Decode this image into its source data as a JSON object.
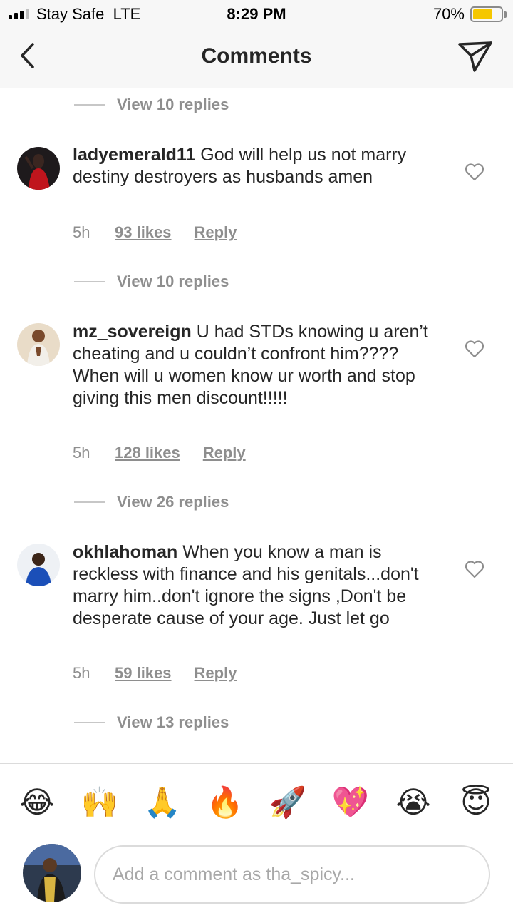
{
  "status_bar": {
    "carrier": "Stay Safe",
    "network": "LTE",
    "time": "8:29 PM",
    "battery": "70%",
    "battery_level": 0.7
  },
  "header": {
    "title": "Comments",
    "back_icon": "chevron-left-icon",
    "share_icon": "paper-plane-icon"
  },
  "view_replies": [
    {
      "label": "View 10 replies"
    },
    {
      "label": "View 10 replies"
    },
    {
      "label": "View 26 replies"
    },
    {
      "label": "View 13 replies"
    }
  ],
  "comments": [
    {
      "username": "ladyemerald11",
      "text": "God will help us not marry destiny destroyers as husbands amen",
      "time": "5h",
      "likes": "93 likes",
      "reply": "Reply"
    },
    {
      "username": "mz_sovereign",
      "text": "U had STDs knowing u aren’t cheating and u couldn’t confront him???? When will u women know ur worth and stop giving this men discount!!!!!",
      "time": "5h",
      "likes": "128 likes",
      "reply": "Reply"
    },
    {
      "username": "okhlahoman",
      "text": "When you know a man is reckless with finance and his genitals...don't marry him..don't ignore the signs ,Don't be desperate cause of your age. Just let go",
      "time": "5h",
      "likes": "59 likes",
      "reply": "Reply"
    }
  ],
  "emojis": [
    "😂",
    "🙌",
    "🙏",
    "🔥",
    "🚀",
    "💖",
    "😭",
    "😇"
  ],
  "composer": {
    "placeholder": "Add a comment as tha_spicy..."
  }
}
